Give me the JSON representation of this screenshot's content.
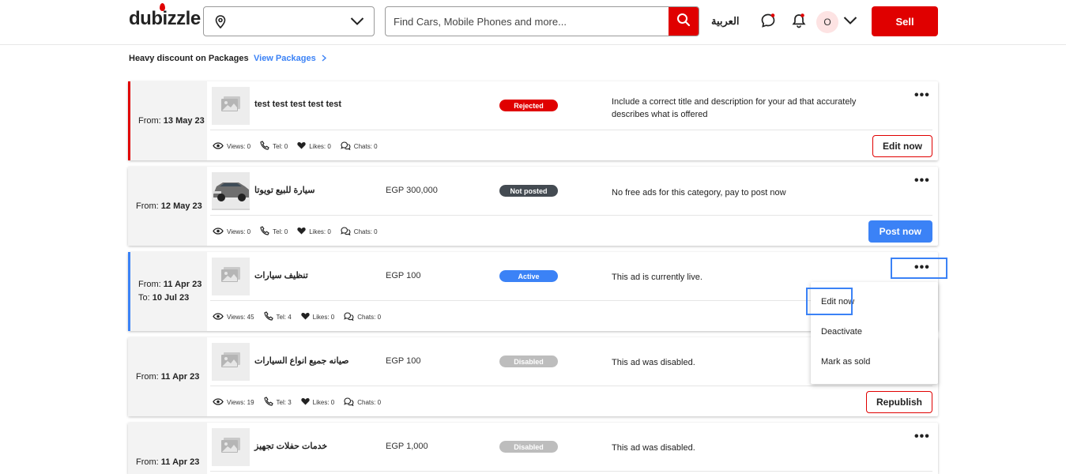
{
  "header": {
    "logo": "dubizzle",
    "location_value": "",
    "search_placeholder": "Find Cars, Mobile Phones and more...",
    "language": "العربية",
    "avatar_initial": "O",
    "sell_label": "Sell"
  },
  "promo": {
    "text": "Heavy discount on Packages",
    "link": "View Packages"
  },
  "ads": [
    {
      "from_label": "From:",
      "from_date": "13 May 23",
      "to_label": "",
      "to_date": "",
      "title": "test test test test test",
      "price": "",
      "status": "Rejected",
      "message": "Include a correct title and description for your ad that accurately describes what is offered",
      "views": "Views: 0",
      "tel": "Tel: 0",
      "likes": "Likes: 0",
      "chats": "Chats: 0",
      "action": "Edit now"
    },
    {
      "from_label": "From:",
      "from_date": "12 May 23",
      "to_label": "",
      "to_date": "",
      "title": "سيارة للبيع تويوتا",
      "price": "EGP 300,000",
      "status": "Not posted",
      "message": "No free ads for this category, pay to post now",
      "views": "Views: 0",
      "tel": "Tel: 0",
      "likes": "Likes: 0",
      "chats": "Chats: 0",
      "action": "Post now"
    },
    {
      "from_label": "From:",
      "from_date": "11 Apr 23",
      "to_label": "To:",
      "to_date": "10 Jul 23",
      "title": "تنظيف سيارات",
      "price": "EGP 100",
      "status": "Active",
      "message": "This ad is currently live.",
      "views": "Views: 45",
      "tel": "Tel: 4",
      "likes": "Likes: 0",
      "chats": "Chats: 0",
      "action": ""
    },
    {
      "from_label": "From:",
      "from_date": "11 Apr 23",
      "to_label": "",
      "to_date": "",
      "title": "صيانه جميع انواع السيارات",
      "price": "EGP 100",
      "status": "Disabled",
      "message": "This ad was disabled.",
      "views": "Views: 19",
      "tel": "Tel: 3",
      "likes": "Likes: 0",
      "chats": "Chats: 0",
      "action": "Republish"
    },
    {
      "from_label": "From:",
      "from_date": "11 Apr 23",
      "to_label": "",
      "to_date": "",
      "title": "خدمات حفلات تجهيز",
      "price": "EGP 1,000",
      "status": "Disabled",
      "message": "This ad was disabled.",
      "views": "",
      "tel": "",
      "likes": "",
      "chats": "",
      "action": ""
    }
  ],
  "context_menu": {
    "items": [
      "Edit now",
      "Deactivate",
      "Mark as sold"
    ]
  },
  "colors": {
    "brand_red": "#e00000",
    "accent_blue": "#3b82f6",
    "badge_dark": "#444b52",
    "badge_disabled": "#bdbdbd"
  }
}
